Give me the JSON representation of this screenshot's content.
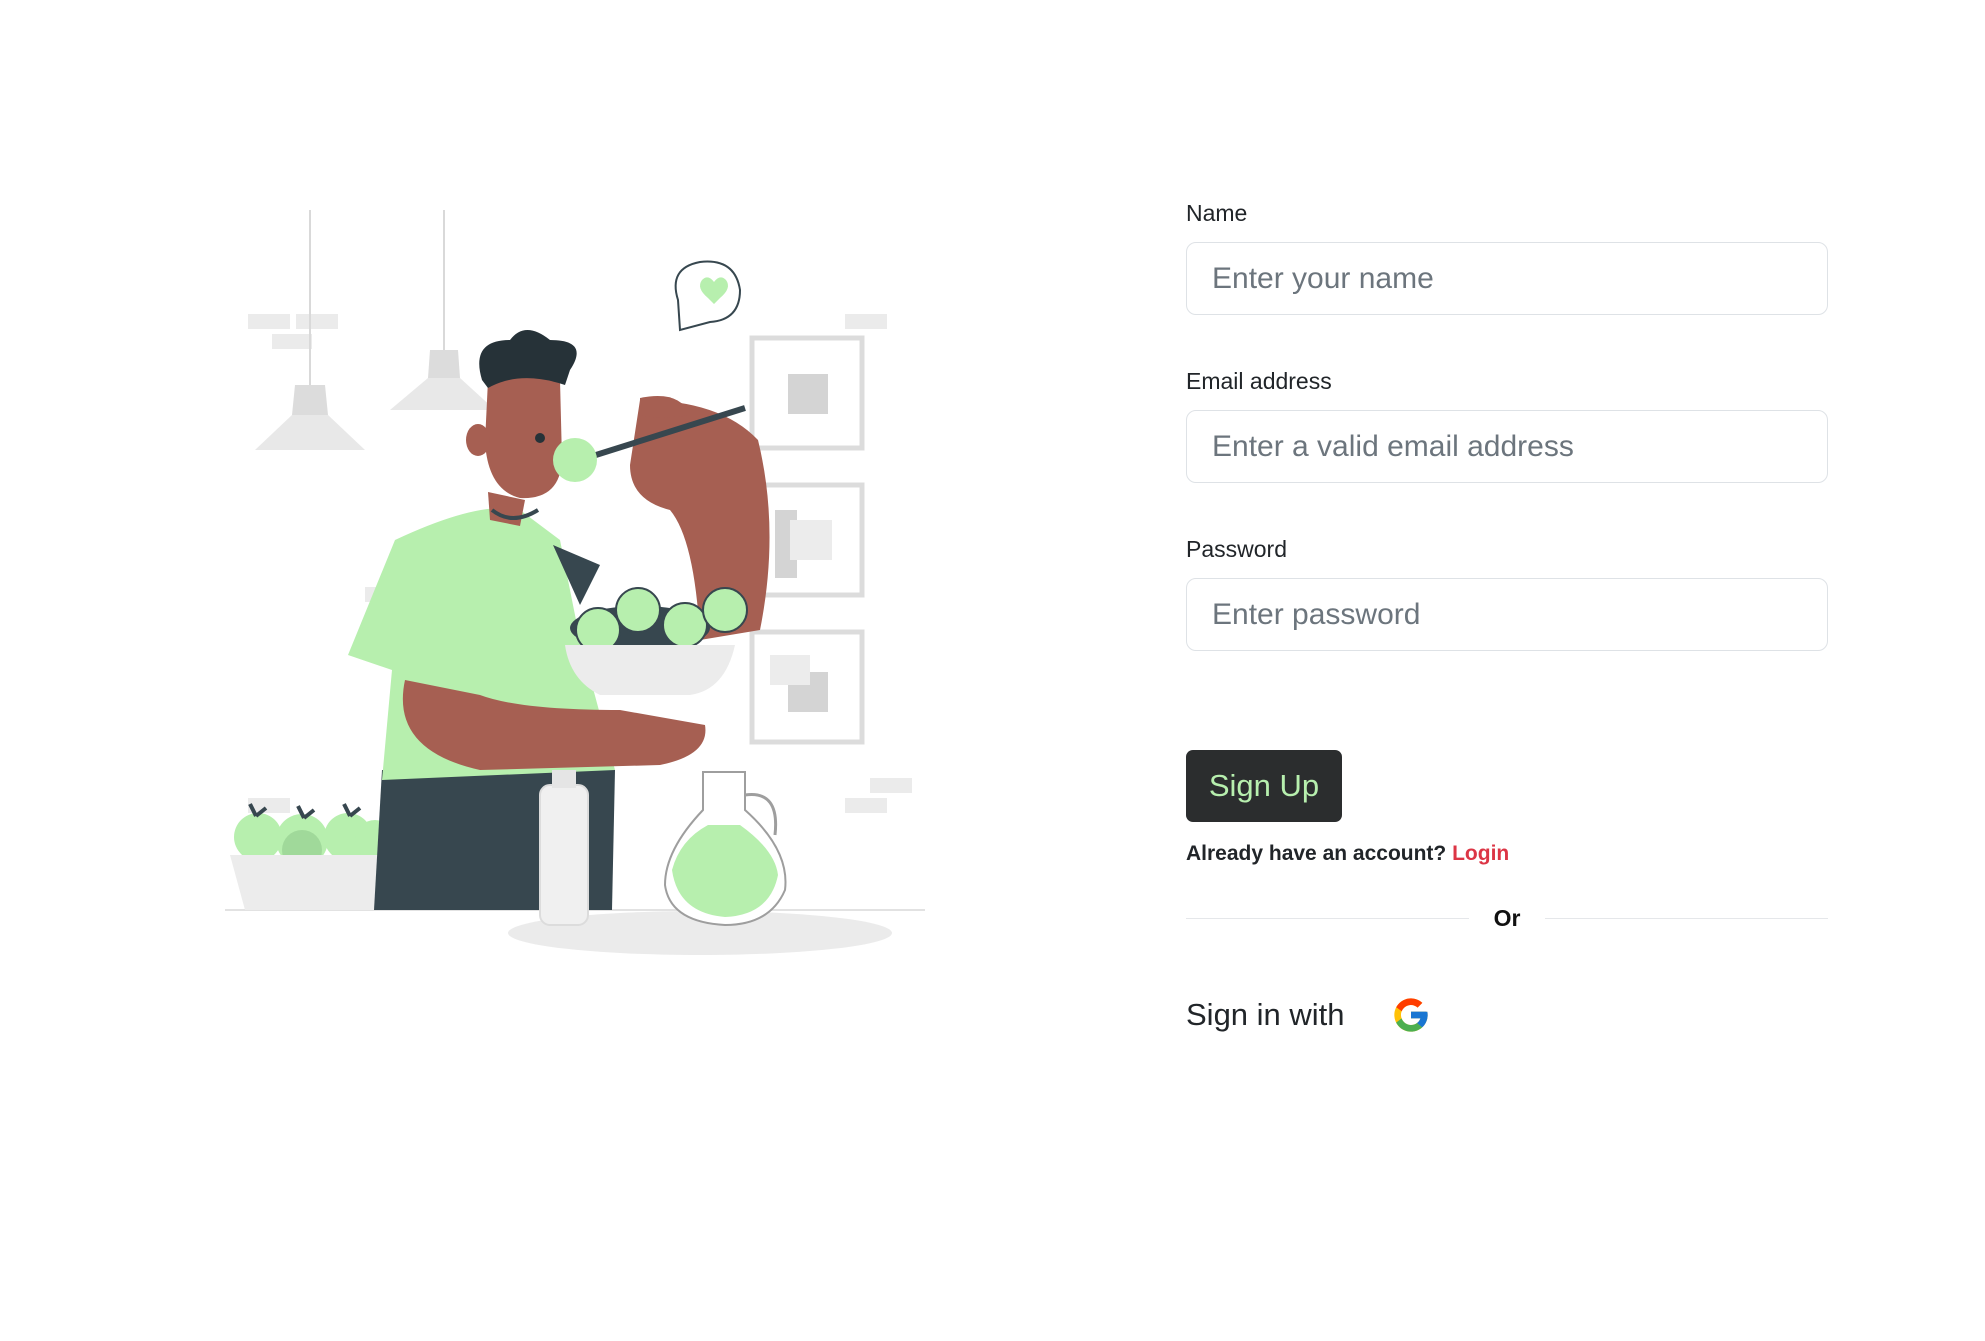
{
  "form": {
    "name_label": "Name",
    "name_placeholder": "Enter your name",
    "name_value": "",
    "email_label": "Email address",
    "email_placeholder": "Enter a valid email address",
    "email_value": "",
    "password_label": "Password",
    "password_placeholder": "Enter password",
    "password_value": "",
    "signup_button": "Sign Up",
    "have_account_text": "Already have an account?",
    "login_link": "Login",
    "divider_text": "Or",
    "signin_with_text": "Sign in with"
  },
  "icons": {
    "google": "google-icon",
    "illustration": "healthy-eating-illustration"
  },
  "colors": {
    "primary_button_bg": "#2b2d2e",
    "primary_button_text": "#b7efae",
    "login_link": "#dc3545",
    "illustration_green": "#b7efae",
    "illustration_skin": "#a65f52",
    "illustration_dark": "#37474f"
  }
}
